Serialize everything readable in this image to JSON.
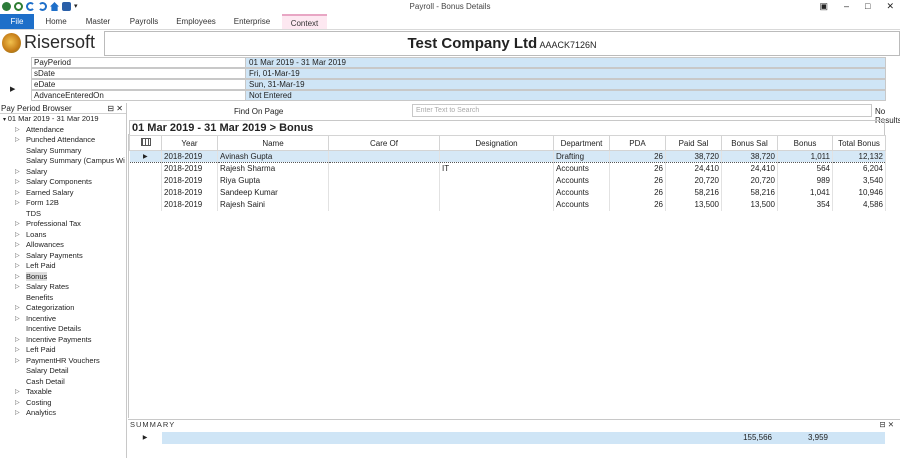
{
  "window": {
    "title": "Payroll - Bonus Details",
    "controls": [
      "▣",
      "–",
      "□",
      "✕"
    ]
  },
  "ribbon": {
    "tabs": [
      "File",
      "Home",
      "Master",
      "Payrolls",
      "Employees",
      "Enterprise",
      "Context"
    ]
  },
  "header": {
    "logo_text": "Risersoft",
    "company_name": "Test Company Ltd",
    "company_code": "AAACK7126N"
  },
  "properties": [
    {
      "key": "PayPeriod",
      "value": "01 Mar 2019 - 31 Mar 2019"
    },
    {
      "key": "sDate",
      "value": "Fri, 01-Mar-19"
    },
    {
      "key": "eDate",
      "value": "Sun, 31-Mar-19"
    },
    {
      "key": "AdvanceEnteredOn",
      "value": "Not Entered"
    }
  ],
  "browser": {
    "title": "Pay Period Browser",
    "controls": "⊟ ✕",
    "root": "01 Mar 2019 - 31 Mar 2019",
    "items": [
      {
        "label": "Attendance",
        "expandable": true
      },
      {
        "label": "Punched Attendance",
        "expandable": true
      },
      {
        "label": "Salary Summary",
        "expandable": false
      },
      {
        "label": "Salary Summary (Campus Wi",
        "expandable": false
      },
      {
        "label": "Salary",
        "expandable": true
      },
      {
        "label": "Salary Components",
        "expandable": true
      },
      {
        "label": "Earned Salary",
        "expandable": true
      },
      {
        "label": "Form 12B",
        "expandable": true
      },
      {
        "label": "TDS",
        "expandable": false
      },
      {
        "label": "Professional Tax",
        "expandable": true
      },
      {
        "label": "Loans",
        "expandable": true
      },
      {
        "label": "Allowances",
        "expandable": true
      },
      {
        "label": "Salary Payments",
        "expandable": true
      },
      {
        "label": "Left Paid",
        "expandable": true
      },
      {
        "label": "Bonus",
        "expandable": true,
        "selected": true
      },
      {
        "label": "Salary Rates",
        "expandable": true
      },
      {
        "label": "Benefits",
        "expandable": false
      },
      {
        "label": "Categorization",
        "expandable": true
      },
      {
        "label": "Incentive",
        "expandable": true
      },
      {
        "label": "Incentive Details",
        "expandable": false
      },
      {
        "label": "Incentive Payments",
        "expandable": true
      },
      {
        "label": "Left Paid",
        "expandable": true
      },
      {
        "label": "PaymentHR Vouchers",
        "expandable": true
      },
      {
        "label": "Salary Detail",
        "expandable": false
      },
      {
        "label": "Cash Detail",
        "expandable": false
      },
      {
        "label": "Taxable",
        "expandable": true
      },
      {
        "label": "Costing",
        "expandable": true
      },
      {
        "label": "Analytics",
        "expandable": true
      }
    ]
  },
  "find": {
    "label": "Find On Page",
    "placeholder": "Enter Text to Search",
    "result": "No Results"
  },
  "grid": {
    "title": "01 Mar 2019 - 31 Mar 2019 > Bonus",
    "columns": [
      "Year",
      "Name",
      "Care Of",
      "Designation",
      "Department",
      "PDA",
      "Paid Sal",
      "Bonus Sal",
      "Bonus",
      "Total Bonus"
    ],
    "rows": [
      {
        "year": "2018-2019",
        "name": "Avinash  Gupta",
        "care_of": "",
        "designation": "",
        "department": "Drafting",
        "pda": "26",
        "paid_sal": "38,720",
        "bonus_sal": "38,720",
        "bonus": "1,011",
        "total_bonus": "12,132"
      },
      {
        "year": "2018-2019",
        "name": "Rajesh Sharma",
        "care_of": "",
        "designation": "IT",
        "department": "Accounts",
        "pda": "26",
        "paid_sal": "24,410",
        "bonus_sal": "24,410",
        "bonus": "564",
        "total_bonus": "6,204"
      },
      {
        "year": "2018-2019",
        "name": "Riya Gupta",
        "care_of": "",
        "designation": "",
        "department": "Accounts",
        "pda": "26",
        "paid_sal": "20,720",
        "bonus_sal": "20,720",
        "bonus": "989",
        "total_bonus": "3,540"
      },
      {
        "year": "2018-2019",
        "name": "Sandeep  Kumar",
        "care_of": "",
        "designation": "",
        "department": "Accounts",
        "pda": "26",
        "paid_sal": "58,216",
        "bonus_sal": "58,216",
        "bonus": "1,041",
        "total_bonus": "10,946"
      },
      {
        "year": "2018-2019",
        "name": "Rajesh Saini",
        "care_of": "",
        "designation": "",
        "department": "Accounts",
        "pda": "26",
        "paid_sal": "13,500",
        "bonus_sal": "13,500",
        "bonus": "354",
        "total_bonus": "4,586"
      }
    ]
  },
  "summary": {
    "title": "SUMMARY",
    "controls": "⊟ ✕",
    "bonus_sal_total": "155,566",
    "bonus_total": "3,959"
  }
}
